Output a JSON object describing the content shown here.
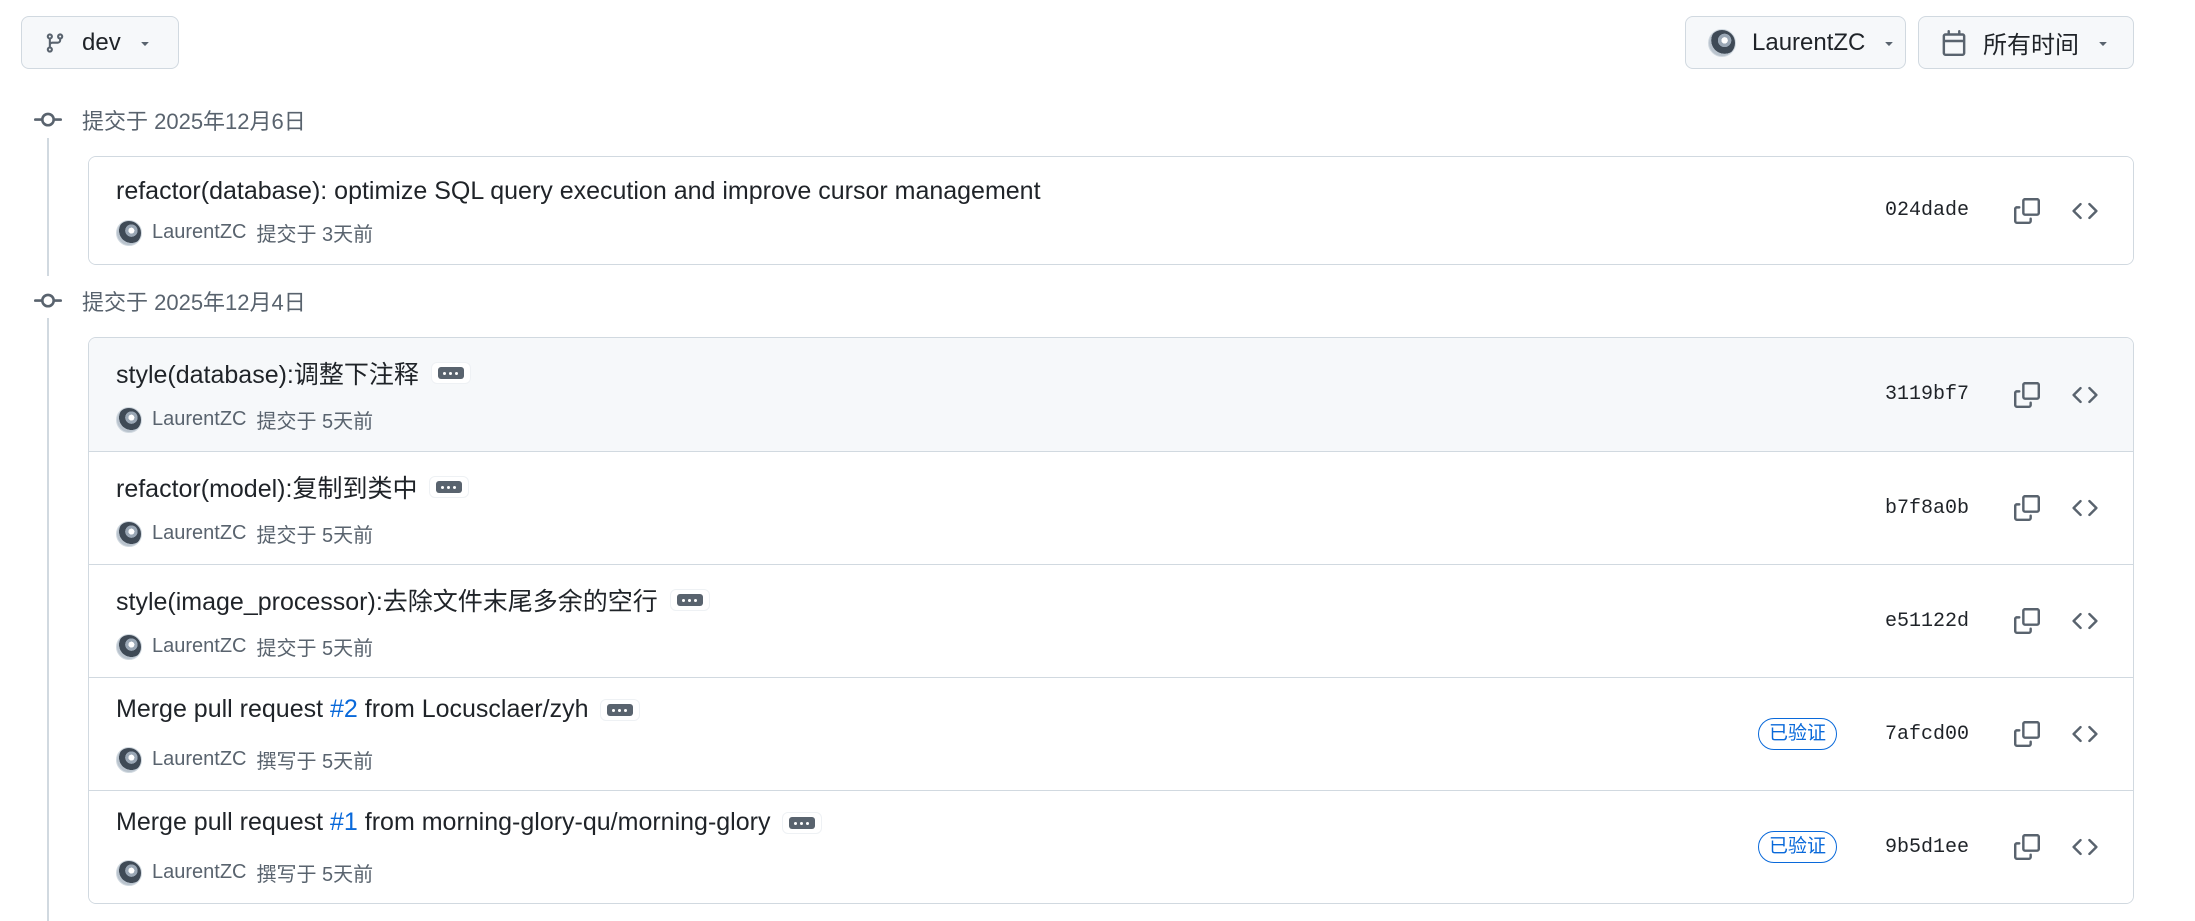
{
  "toolbar": {
    "branch_label": "dev",
    "author_label": "LaurentZC",
    "time_label": "所有时间"
  },
  "groups": [
    {
      "header": "提交于 2025年12月6日",
      "commits": [
        {
          "message": "refactor(database): optimize SQL query execution and improve cursor management",
          "author": "LaurentZC",
          "meta": "提交于 3天前",
          "sha": "024dade"
        }
      ]
    },
    {
      "header": "提交于 2025年12月4日",
      "commits": [
        {
          "message": "style(database):调整下注释",
          "author": "LaurentZC",
          "meta": "提交于 5天前",
          "sha": "3119bf7"
        },
        {
          "message": "refactor(model):复制到类中",
          "author": "LaurentZC",
          "meta": "提交于 5天前",
          "sha": "b7f8a0b"
        },
        {
          "message": "style(image_processor):去除文件末尾多余的空行",
          "author": "LaurentZC",
          "meta": "提交于 5天前",
          "sha": "e51122d"
        },
        {
          "message_prefix": "Merge pull request ",
          "pr": "#2",
          "message_suffix": " from Locusclaer/zyh",
          "author": "LaurentZC",
          "meta": "撰写于 5天前",
          "badge": "已验证",
          "sha": "7afcd00"
        },
        {
          "message_prefix": "Merge pull request ",
          "pr": "#1",
          "message_suffix": " from morning-glory-qu/morning-glory",
          "author": "LaurentZC",
          "meta": "撰写于 5天前",
          "badge": "已验证",
          "sha": "9b5d1ee"
        }
      ]
    }
  ],
  "icons": {
    "branch": "git-branch-icon",
    "calendar": "calendar-icon",
    "commit": "git-commit-icon",
    "copy": "copy-icon",
    "code": "code-icon",
    "caret": "caret-down-icon",
    "ellipsis": "ellipsis-icon"
  },
  "colors": {
    "link": "#0969da",
    "muted": "#59636e",
    "border": "#d1d9e0",
    "hover_row": "#f6f8fa"
  }
}
